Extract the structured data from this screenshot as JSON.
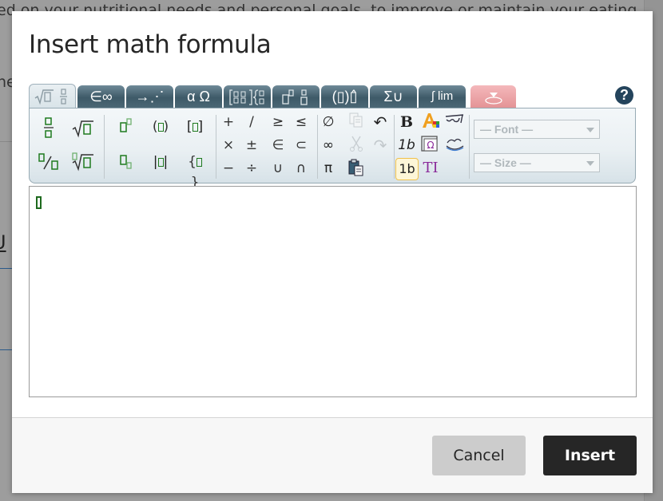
{
  "background": {
    "text_line_1": "ed on your nutritional needs and personal goals, to improve or maintain your eating",
    "text_line_2": "ne",
    "text_line_3": "U"
  },
  "dialog": {
    "title": "Insert math formula",
    "help_icon": "?",
    "tabs": [
      {
        "name": "general",
        "label": "√▯ ▯⁄▯",
        "active": true
      },
      {
        "name": "symbols",
        "label": "∈∞"
      },
      {
        "name": "arrows",
        "label": "→⋰"
      },
      {
        "name": "greek",
        "label": "α Ω"
      },
      {
        "name": "matrices",
        "label": "[▯▯]{▯"
      },
      {
        "name": "scripts",
        "label": "▯▯ ▯▯"
      },
      {
        "name": "decorations",
        "label": "(▯)▯̂"
      },
      {
        "name": "big-operators",
        "label": "Σ∪"
      },
      {
        "name": "calculus",
        "label": "∫ lim"
      },
      {
        "name": "custom",
        "label": "⏏",
        "color": "#e8999c"
      }
    ],
    "toolbar": {
      "layout_buttons": [
        {
          "name": "fraction",
          "label": "▯/▯"
        },
        {
          "name": "square-root",
          "label": "√▯"
        },
        {
          "name": "bevelled-fraction",
          "label": "▯/▯"
        },
        {
          "name": "nth-root",
          "label": "▯√▯"
        },
        {
          "name": "superscript",
          "label": "▯▯"
        },
        {
          "name": "parentheses",
          "label": "(▯)"
        },
        {
          "name": "brackets",
          "label": "[▯]"
        },
        {
          "name": "subscript",
          "label": "▯▯"
        },
        {
          "name": "absolute-value",
          "label": "|▯|"
        },
        {
          "name": "braces",
          "label": "{▯}"
        }
      ],
      "operators": [
        "+",
        "/",
        "≥",
        "≤",
        "×",
        "±",
        "∈",
        "⊂",
        "−",
        "÷",
        "∪",
        "∩"
      ],
      "misc": [
        "∅",
        "∞",
        "π"
      ],
      "edit": {
        "copy": "copy",
        "cut": "cut",
        "paste": "paste",
        "undo": "↶",
        "redo": "↷"
      },
      "style": {
        "bold": "B",
        "italic": "1b",
        "normal": "1b",
        "text": "TI"
      },
      "font_placeholder": "— Font —",
      "size_placeholder": "— Size —"
    },
    "buttons": {
      "cancel": "Cancel",
      "insert": "Insert"
    }
  }
}
